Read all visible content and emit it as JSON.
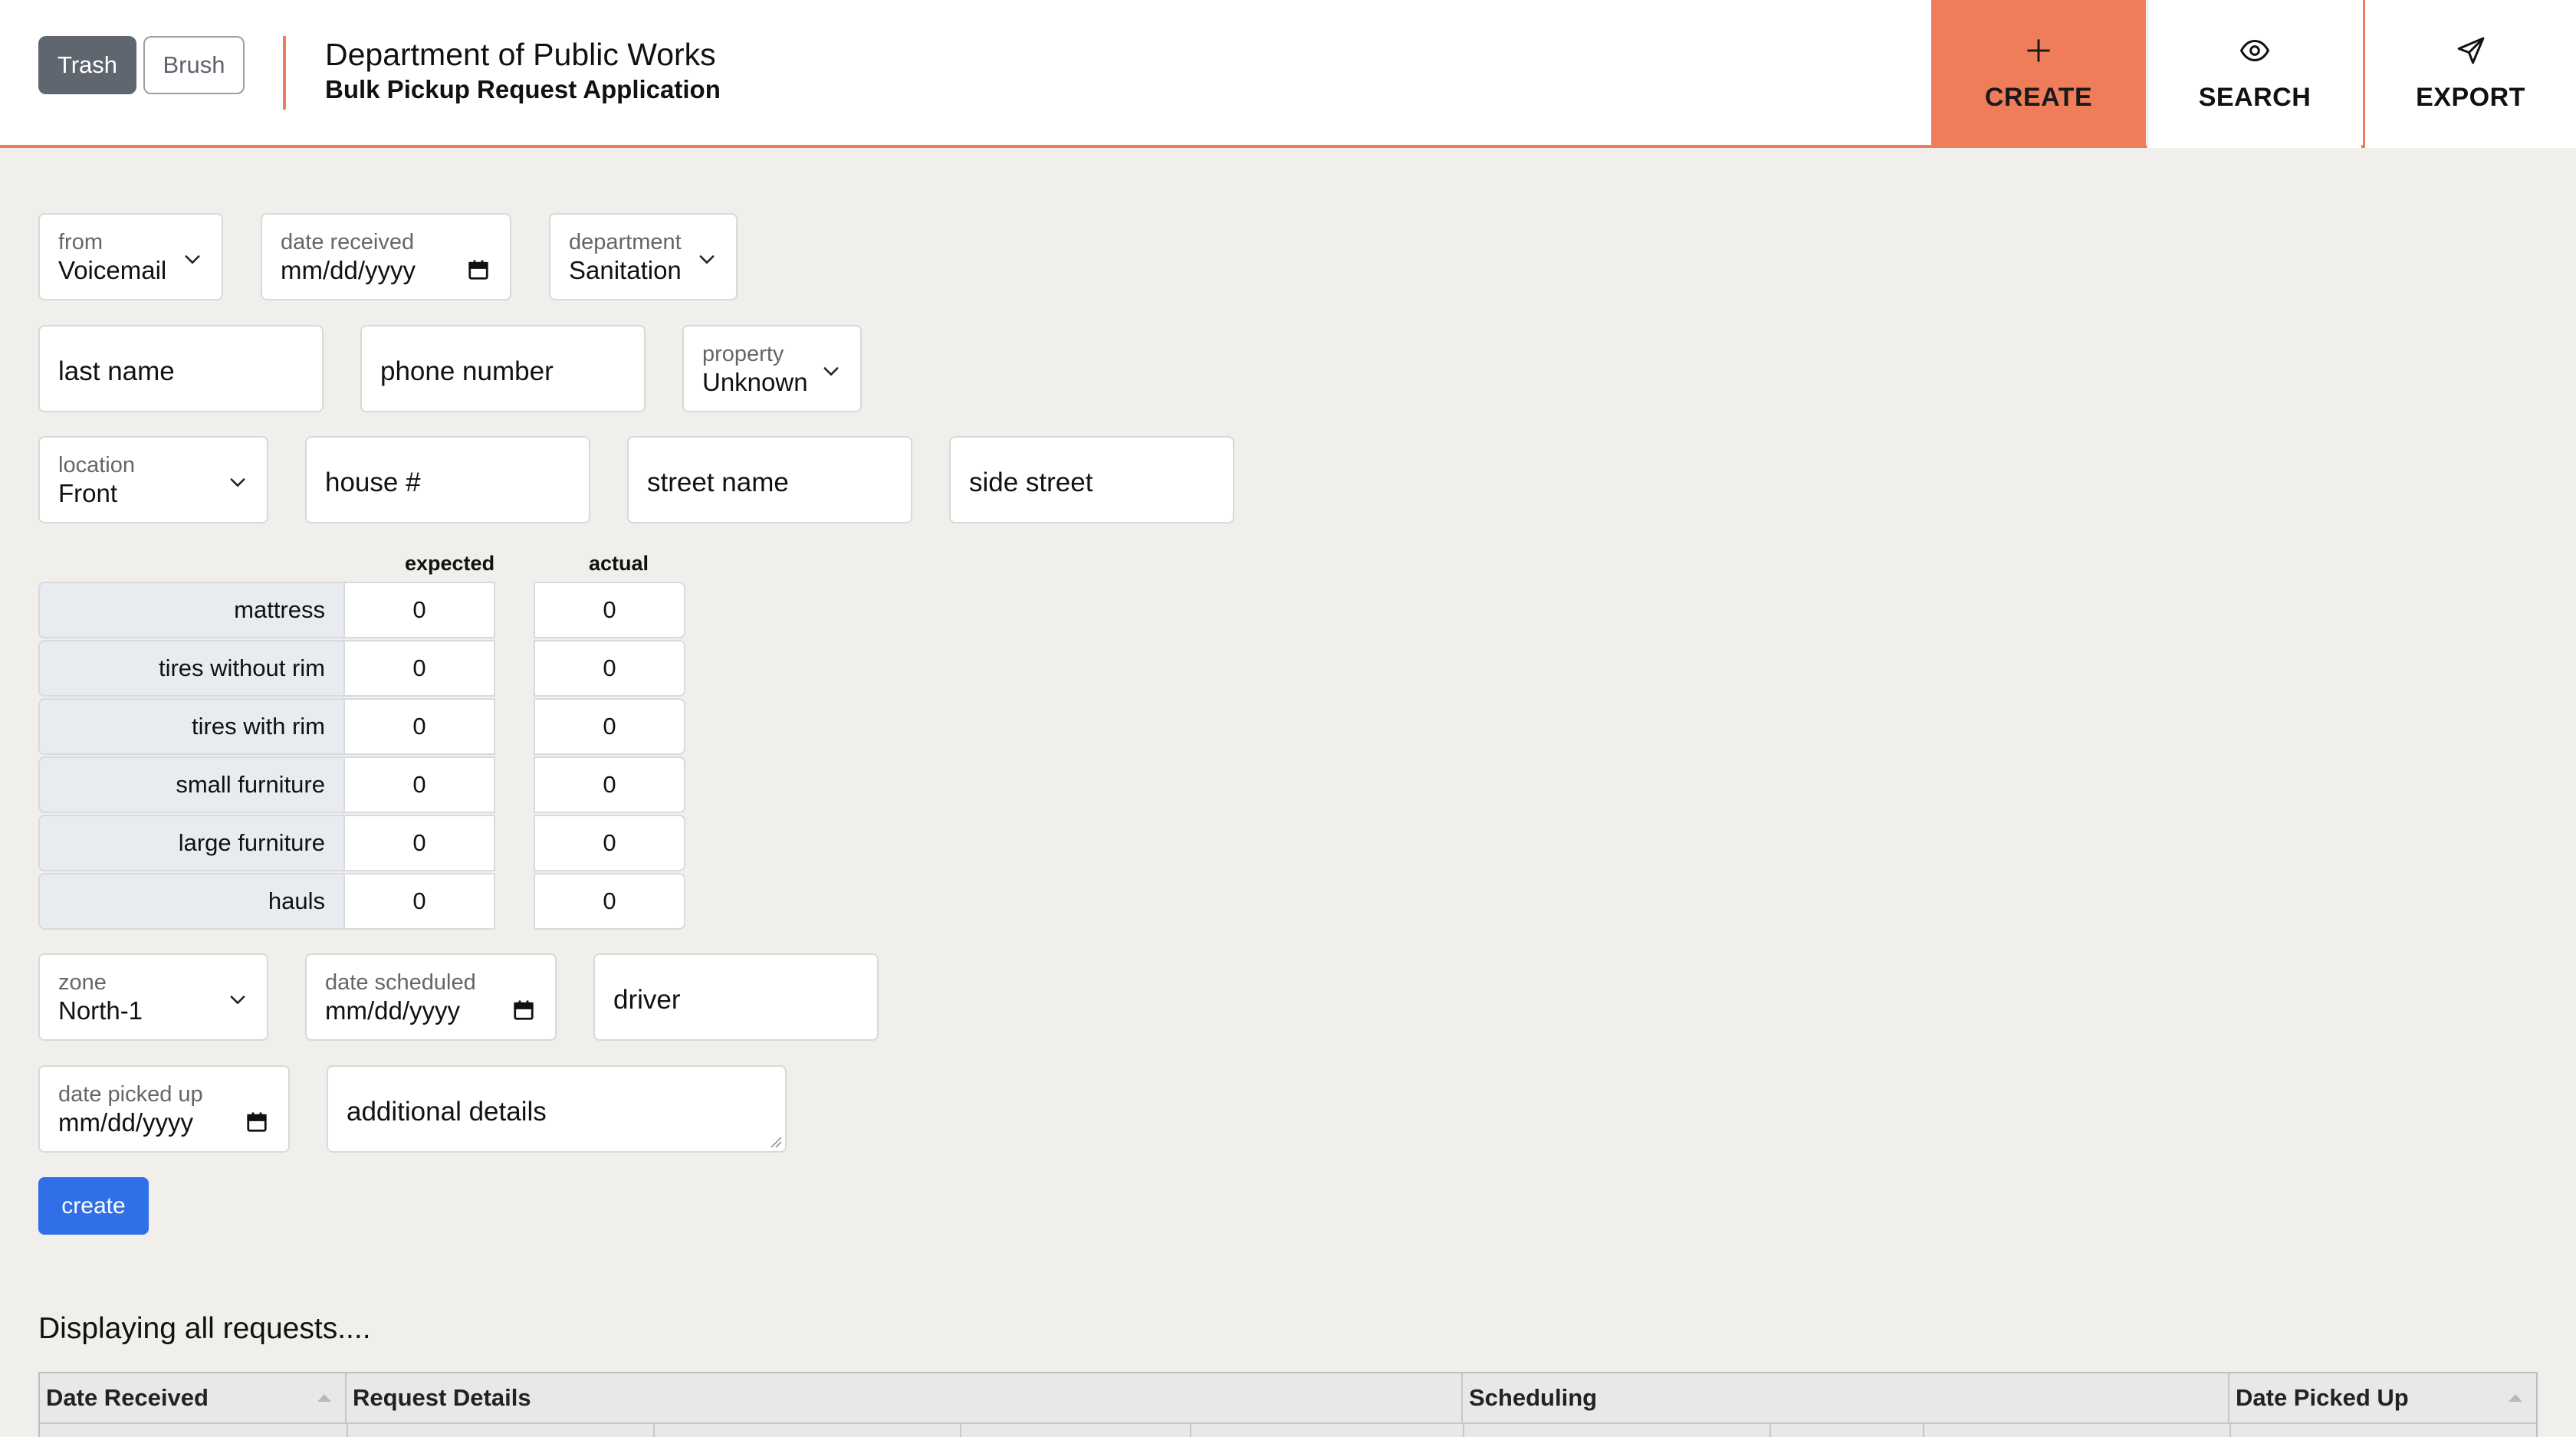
{
  "header": {
    "toggle": {
      "trash": "Trash",
      "brush": "Brush"
    },
    "title": "Department of Public Works",
    "subtitle": "Bulk Pickup Request Application",
    "nav": {
      "create": "CREATE",
      "search": "SEARCH",
      "export": "EXPORT"
    },
    "accent_color": "#ef7d5a"
  },
  "form": {
    "from": {
      "label": "from",
      "value": "Voicemail"
    },
    "date_received": {
      "label": "date received",
      "value": "mm/dd/yyyy"
    },
    "department": {
      "label": "department",
      "value": "Sanitation"
    },
    "last_name": {
      "placeholder": "last name"
    },
    "phone_number": {
      "placeholder": "phone number"
    },
    "property": {
      "label": "property",
      "value": "Unknown"
    },
    "location": {
      "label": "location",
      "value": "Front"
    },
    "house_number": {
      "placeholder": "house #"
    },
    "street_name": {
      "placeholder": "street name"
    },
    "side_street": {
      "placeholder": "side street"
    },
    "items": {
      "expected_header": "expected",
      "actual_header": "actual",
      "rows": [
        {
          "label": "mattress",
          "expected": "0",
          "actual": "0"
        },
        {
          "label": "tires without rim",
          "expected": "0",
          "actual": "0"
        },
        {
          "label": "tires with rim",
          "expected": "0",
          "actual": "0"
        },
        {
          "label": "small furniture",
          "expected": "0",
          "actual": "0"
        },
        {
          "label": "large furniture",
          "expected": "0",
          "actual": "0"
        },
        {
          "label": "hauls",
          "expected": "0",
          "actual": "0"
        }
      ]
    },
    "zone": {
      "label": "zone",
      "value": "North-1"
    },
    "date_scheduled": {
      "label": "date scheduled",
      "value": "mm/dd/yyyy"
    },
    "driver": {
      "placeholder": "driver"
    },
    "date_picked_up": {
      "label": "date picked up",
      "value": "mm/dd/yyyy"
    },
    "additional_details": {
      "placeholder": "additional details"
    },
    "submit_label": "create",
    "submit_color": "#2f6fe8"
  },
  "results": {
    "heading": "Displaying all requests....",
    "columns": {
      "date_received": "Date Received",
      "request_details": "Request Details",
      "scheduling": "Scheduling",
      "date_picked_up": "Date Picked Up"
    }
  }
}
